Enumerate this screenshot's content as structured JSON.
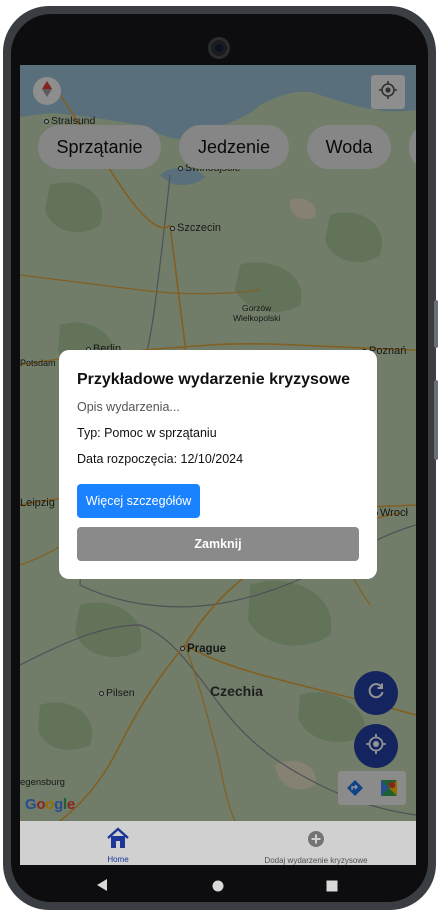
{
  "map": {
    "labels": {
      "stralsund": "Stralsund",
      "swinoujscie": "Świnoujście",
      "szczecin": "Szczecin",
      "gorzow": "Gorzów\nWielkopolski",
      "potsdam": "Potsdam",
      "berlin": "Berlin",
      "poznan": "Poznań",
      "leipzig": "Leipzig",
      "wroclaw": "Wrocł",
      "prague": "Prague",
      "pilsen": "Pilsen",
      "czechia": "Czechia",
      "regensburg": "egensburg"
    },
    "google_logo": "Google"
  },
  "top": {
    "compass_icon": "compass-icon",
    "locate_icon": "my-location-icon"
  },
  "categories": [
    "Sprzątanie",
    "Jedzenie",
    "Woda"
  ],
  "modal": {
    "title": "Przykładowe wydarzenie kryzysowe",
    "description": "Opis wydarzenia...",
    "type": "Typ: Pomoc w sprzątaniu",
    "start_date": "Data rozpoczęcia: 12/10/2024",
    "more_button": "Więcej szczegółów",
    "close_button": "Zamknij"
  },
  "fabs": {
    "refresh_icon": "refresh-icon",
    "location_icon": "gps-fixed-icon"
  },
  "bottom_nav": {
    "items": [
      {
        "label": "Home",
        "icon": "home-icon",
        "active": true
      },
      {
        "label": "Dodaj wydarzenie kryzysowe",
        "icon": "add-circle-icon",
        "active": false
      }
    ]
  },
  "colors": {
    "accent_blue": "#1a82ff",
    "fab_blue": "#233ea3",
    "nav_active": "#1e3aa0",
    "close_gray": "#8a8a8a"
  }
}
